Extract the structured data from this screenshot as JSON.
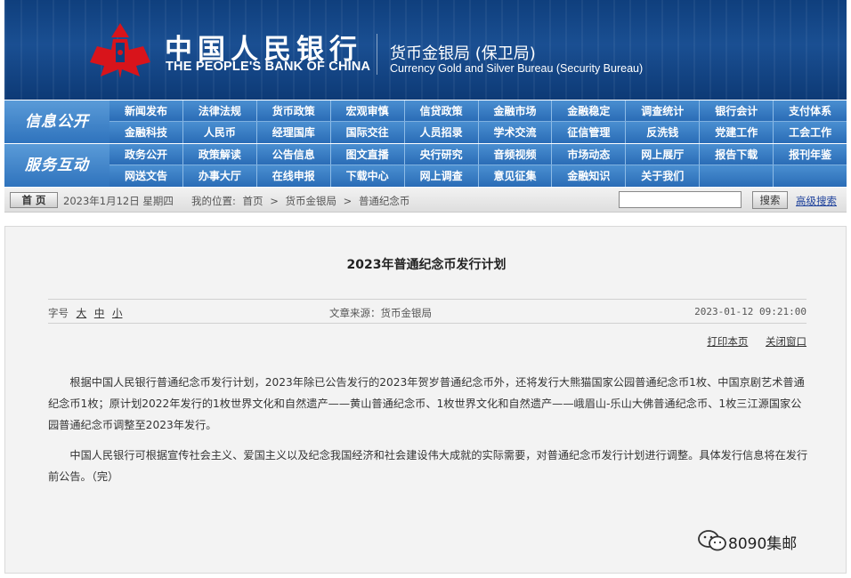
{
  "header": {
    "bank_name_cn": "中国人民银行",
    "bank_name_en": "THE PEOPLE'S BANK OF CHINA",
    "bureau_cn": "货币金银局 (保卫局)",
    "bureau_en": "Currency  Gold and Silver Bureau (Security Bureau)"
  },
  "nav": {
    "sections": [
      {
        "label": "信息公开",
        "rows": [
          [
            "新闻发布",
            "法律法规",
            "货币政策",
            "宏观审慎",
            "信贷政策",
            "金融市场",
            "金融稳定",
            "调查统计",
            "银行会计",
            "支付体系"
          ],
          [
            "金融科技",
            "人民币",
            "经理国库",
            "国际交往",
            "人员招录",
            "学术交流",
            "征信管理",
            "反洗钱",
            "党建工作",
            "工会工作"
          ]
        ]
      },
      {
        "label": "服务互动",
        "rows": [
          [
            "政务公开",
            "政策解读",
            "公告信息",
            "图文直播",
            "央行研究",
            "音频视频",
            "市场动态",
            "网上展厅",
            "报告下载",
            "报刊年鉴"
          ],
          [
            "网送文告",
            "办事大厅",
            "在线申报",
            "下载中心",
            "网上调查",
            "意见征集",
            "金融知识",
            "关于我们",
            "",
            ""
          ]
        ]
      }
    ]
  },
  "breadcrumb": {
    "home_label": "首 页",
    "date": "2023年1月12日  星期四",
    "location_label": "我的位置:",
    "path": [
      "首页",
      ">",
      "货币金银局",
      ">",
      "普通纪念币"
    ],
    "search_placeholder": "",
    "search_button": "搜索",
    "advanced_search": "高级搜索"
  },
  "article": {
    "title": "2023年普通纪念币发行计划",
    "font_size_label": "字号",
    "font_sizes": [
      "大",
      "中",
      "小"
    ],
    "source": "文章来源：货币金银局",
    "published": "2023-01-12  09:21:00",
    "print_label": "打印本页",
    "close_label": "关闭窗口",
    "paragraphs": [
      "根据中国人民银行普通纪念币发行计划，2023年除已公告发行的2023年贺岁普通纪念币外，还将发行大熊猫国家公园普通纪念币1枚、中国京剧艺术普通纪念币1枚；原计划2022年发行的1枚世界文化和自然遗产——黄山普通纪念币、1枚世界文化和自然遗产——峨眉山-乐山大佛普通纪念币、1枚三江源国家公园普通纪念币调整至2023年发行。",
      "中国人民银行可根据宣传社会主义、爱国主义以及纪念我国经济和社会建设伟大成就的实际需要，对普通纪念币发行计划进行调整。具体发行信息将在发行前公告。（完）"
    ]
  },
  "watermark": {
    "text": "8090集邮"
  }
}
